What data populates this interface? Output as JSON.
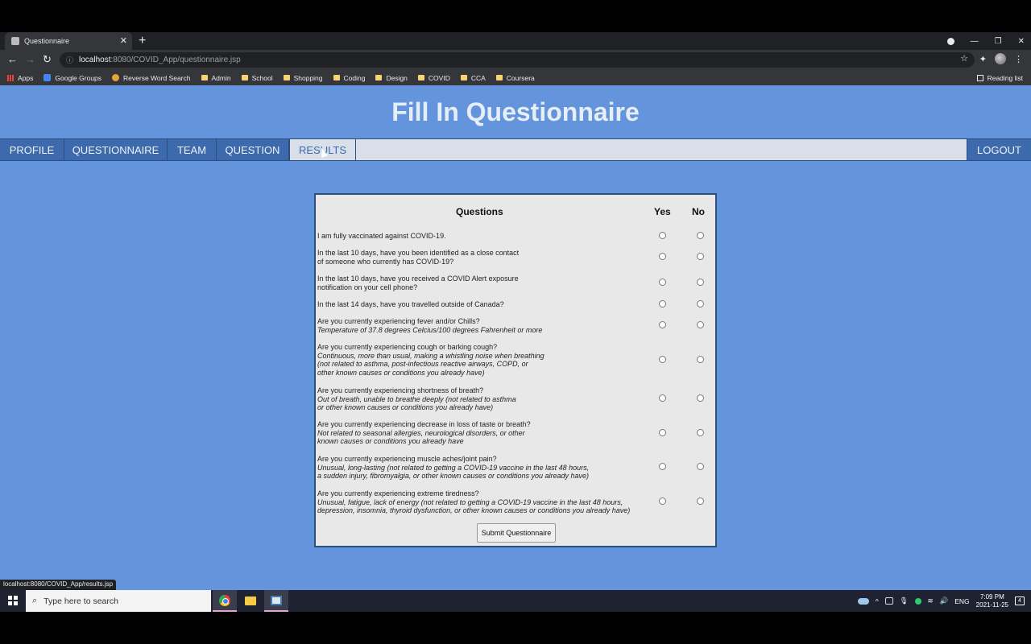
{
  "browser": {
    "tab_title": "Questionnaire",
    "tab_close": "✕",
    "new_tab": "+",
    "url_host": "localhost",
    "url_rest": ":8080/COVID_App/questionnaire.jsp",
    "bookmarks": [
      "Apps",
      "Google Groups",
      "Reverse Word Search",
      "Admin",
      "School",
      "Shopping",
      "Coding",
      "Design",
      "COVID",
      "CCA",
      "Coursera"
    ],
    "reading_list": "Reading list",
    "status_url": "localhost:8080/COVID_App/results.jsp"
  },
  "page": {
    "title": "Fill In Questionnaire",
    "nav": {
      "profile": "PROFILE",
      "questionnaire": "QUESTIONNAIRE",
      "team": "TEAM",
      "question": "QUESTION",
      "results": "RESULTS",
      "logout": "LOGOUT"
    },
    "table": {
      "col_questions": "Questions",
      "col_yes": "Yes",
      "col_no": "No"
    },
    "questions": [
      {
        "lines": [
          "I am fully vaccinated against COVID-19."
        ],
        "sub": []
      },
      {
        "lines": [
          "In the last 10 days, have you been identified as a close contact",
          "of someone who currently has COVID-19?"
        ],
        "sub": []
      },
      {
        "lines": [
          "In the last 10 days, have you received a COVID Alert exposure",
          "notification on your cell phone?"
        ],
        "sub": []
      },
      {
        "lines": [
          "In the last 14 days, have you travelled outside of Canada?"
        ],
        "sub": []
      },
      {
        "lines": [
          "Are you currently experiencing fever and/or Chills?"
        ],
        "sub": [
          "Temperature of 37.8 degrees Celcius/100 degrees Fahrenheit or more"
        ]
      },
      {
        "lines": [
          "Are you currently experiencing cough or barking cough?"
        ],
        "sub": [
          "Continuous, more than usual, making a whistling noise when breathing",
          "(not related to asthma, post-infectious reactive airways, COPD, or",
          "other known causes or conditions you already have)"
        ]
      },
      {
        "lines": [
          "Are you currently experiencing shortness of breath?"
        ],
        "sub": [
          "Out of breath, unable to breathe deeply (not related to asthma",
          "or other known causes or conditions you already have)"
        ]
      },
      {
        "lines": [
          "Are you currently experiencing decrease in loss of taste or breath?"
        ],
        "sub": [
          "Not related to seasonal allergies, neurological disorders, or other",
          "known causes or conditions you already have"
        ]
      },
      {
        "lines": [
          "Are you currently experiencing muscle aches/joint pain?"
        ],
        "sub": [
          "Unusual, long-lasting (not related to getting a COVID-19 vaccine in the last 48 hours,",
          "a sudden injury, fibromyalgia, or other known causes or conditions you already have)"
        ]
      },
      {
        "lines": [
          "Are you currently experiencing extreme tiredness?"
        ],
        "sub": [
          "Unusual, fatigue, lack of energy (not related to getting a COVID-19 vaccine in the last 48 hours,",
          "depression, insomnia, thyroid dysfunction, or other known causes or conditions you already have)"
        ]
      }
    ],
    "submit_label": "Submit Questionnaire"
  },
  "taskbar": {
    "search_placeholder": "Type here to search",
    "language": "ENG",
    "time": "7:09 PM",
    "date": "2021-11-25",
    "notifications": "4"
  },
  "colors": {
    "page_bg": "#6494db",
    "nav_bg": "#3d6aad",
    "navbar_strip": "#d9dfe9"
  }
}
